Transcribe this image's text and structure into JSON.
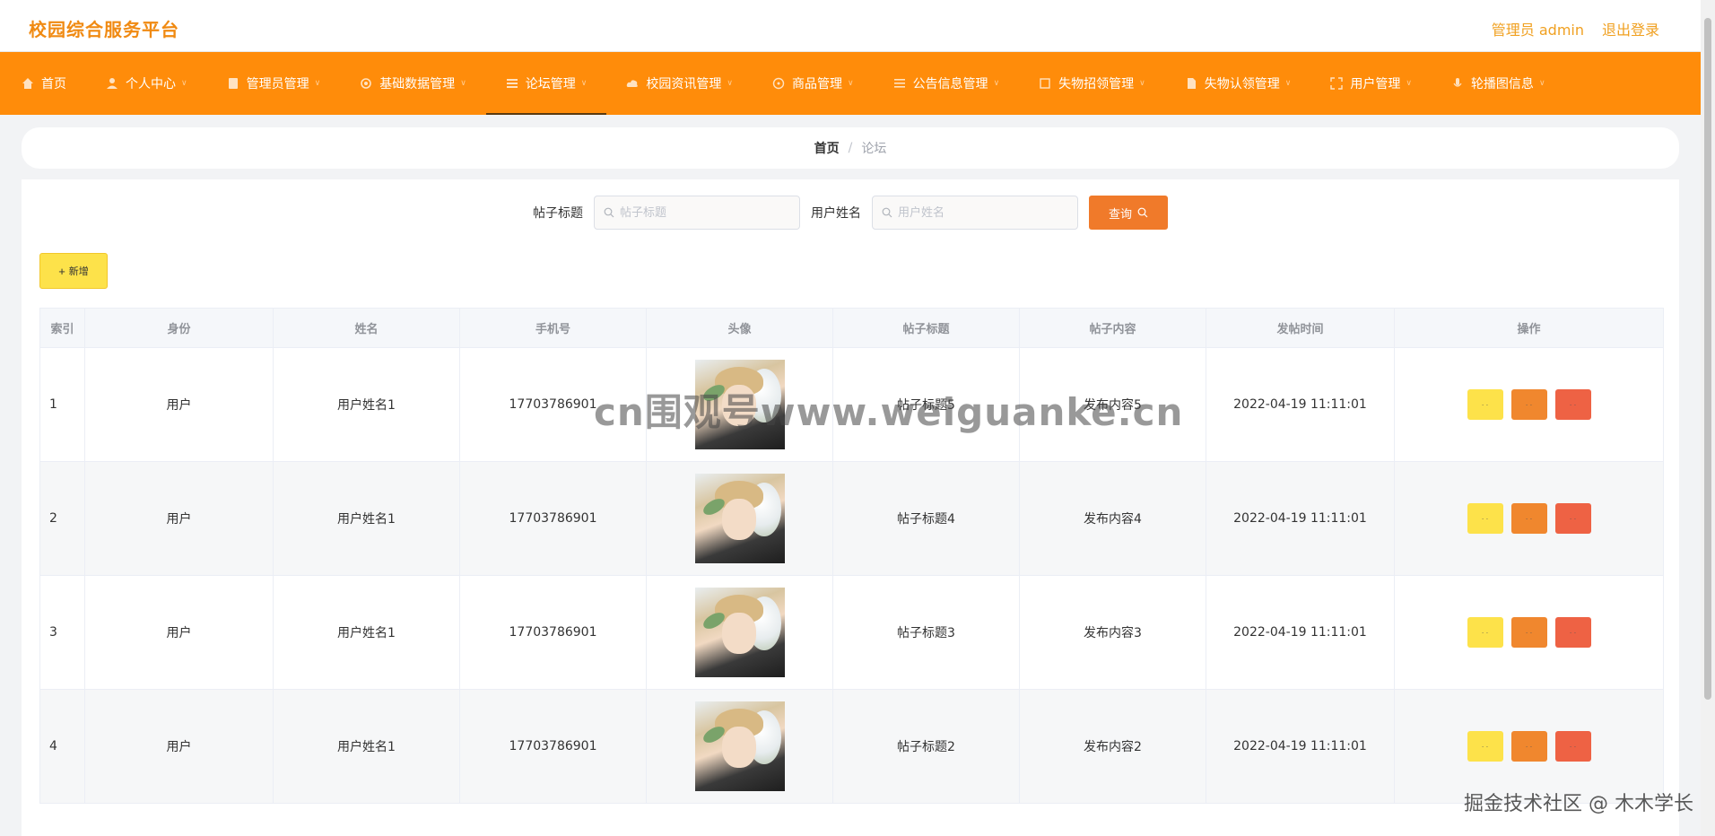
{
  "header": {
    "brand": "校园综合服务平台",
    "user_info": "管理员 admin",
    "logout": "退出登录"
  },
  "nav": {
    "items": [
      {
        "label": "首页",
        "icon": "home-icon"
      },
      {
        "label": "个人中心",
        "icon": "user-icon"
      },
      {
        "label": "管理员管理",
        "icon": "book-icon"
      },
      {
        "label": "基础数据管理",
        "icon": "settings-icon"
      },
      {
        "label": "论坛管理",
        "icon": "list-icon"
      },
      {
        "label": "校园资讯管理",
        "icon": "cloud-icon"
      },
      {
        "label": "商品管理",
        "icon": "circle-icon"
      },
      {
        "label": "公告信息管理",
        "icon": "menu-icon"
      },
      {
        "label": "失物招领管理",
        "icon": "box-icon"
      },
      {
        "label": "失物认领管理",
        "icon": "doc-icon"
      },
      {
        "label": "用户管理",
        "icon": "expand-icon"
      },
      {
        "label": "轮播图信息",
        "icon": "mic-icon"
      }
    ],
    "active_index": 4
  },
  "breadcrumb": {
    "home": "首页",
    "separator": "/",
    "current": "论坛"
  },
  "search": {
    "title_label": "帖子标题",
    "title_placeholder": "帖子标题",
    "name_label": "用户姓名",
    "name_placeholder": "用户姓名",
    "button": "查询"
  },
  "add_button": "新增",
  "table": {
    "columns": [
      "索引",
      "身份",
      "姓名",
      "手机号",
      "头像",
      "帖子标题",
      "帖子内容",
      "发帖时间",
      "操作"
    ],
    "rows": [
      {
        "index": "1",
        "role": "用户",
        "name": "用户姓名1",
        "phone": "17703786901",
        "title": "帖子标题5",
        "content": "发布内容5",
        "time": "2022-04-19 11:11:01"
      },
      {
        "index": "2",
        "role": "用户",
        "name": "用户姓名1",
        "phone": "17703786901",
        "title": "帖子标题4",
        "content": "发布内容4",
        "time": "2022-04-19 11:11:01"
      },
      {
        "index": "3",
        "role": "用户",
        "name": "用户姓名1",
        "phone": "17703786901",
        "title": "帖子标题3",
        "content": "发布内容3",
        "time": "2022-04-19 11:11:01"
      },
      {
        "index": "4",
        "role": "用户",
        "name": "用户姓名1",
        "phone": "17703786901",
        "title": "帖子标题2",
        "content": "发布内容2",
        "time": "2022-04-19 11:11:01"
      }
    ]
  },
  "watermarks": {
    "center": "cn围观号www.weiguanke.cn",
    "corner": "掘金技术社区 @ 木木学长"
  },
  "colors": {
    "brand": "#f08a12",
    "nav_bg": "#ff8c0a",
    "search_button": "#f07a2a",
    "add_button": "#fde24a",
    "view_button": "#fde24a",
    "edit_button": "#f0872e",
    "delete_button": "#ee6244"
  }
}
